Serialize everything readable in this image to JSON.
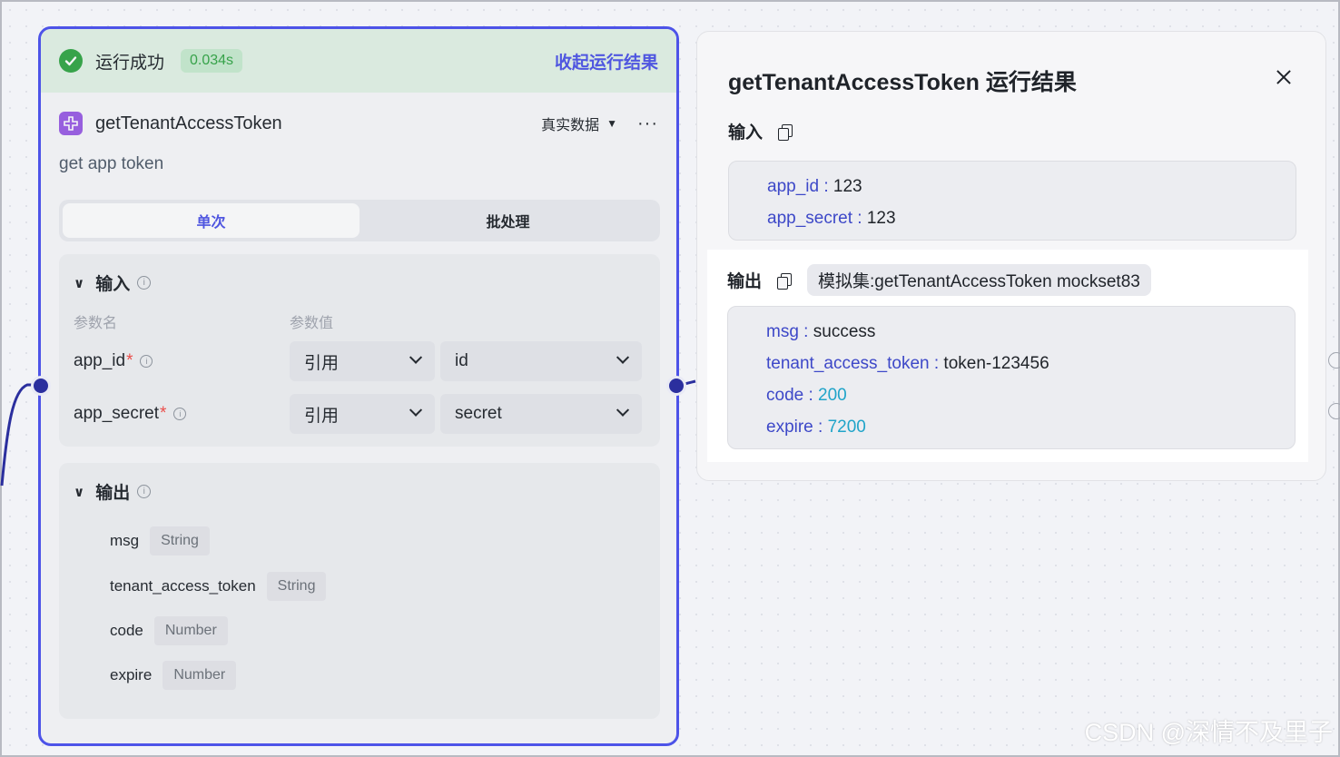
{
  "node": {
    "run_status": "运行成功",
    "run_time": "0.034s",
    "collapse_label": "收起运行结果",
    "title": "getTenantAccessToken",
    "data_mode": "真实数据",
    "more_label": "···",
    "description": "get app token",
    "tabs": [
      {
        "label": "单次",
        "active": true
      },
      {
        "label": "批处理",
        "active": false
      }
    ],
    "input": {
      "heading": "输入",
      "col_name": "参数名",
      "col_value": "参数值",
      "params": [
        {
          "name": "app_id",
          "required": "*",
          "mode": "引用",
          "value": "id"
        },
        {
          "name": "app_secret",
          "required": "*",
          "mode": "引用",
          "value": "secret"
        }
      ]
    },
    "output": {
      "heading": "输出",
      "fields": [
        {
          "name": "msg",
          "type": "String"
        },
        {
          "name": "tenant_access_token",
          "type": "String"
        },
        {
          "name": "code",
          "type": "Number"
        },
        {
          "name": "expire",
          "type": "Number"
        }
      ]
    }
  },
  "result_panel": {
    "title": "getTenantAccessToken 运行结果",
    "input_label": "输入",
    "input": [
      {
        "key": "app_id",
        "value": "123"
      },
      {
        "key": "app_secret",
        "value": "123"
      }
    ],
    "output_label": "输出",
    "mockset_tag": "模拟集:getTenantAccessToken mockset83",
    "output": [
      {
        "key": "msg",
        "value": "success",
        "numeric": false
      },
      {
        "key": "tenant_access_token",
        "value": "token-123456",
        "numeric": false
      },
      {
        "key": "code",
        "value": "200",
        "numeric": true
      },
      {
        "key": "expire",
        "value": "7200",
        "numeric": true
      }
    ]
  },
  "watermark": "CSDN @深情不及里子",
  "colors": {
    "accent": "#4d53e8",
    "success": "#32a645",
    "key": "#3d48c8",
    "number": "#20a4c9"
  }
}
